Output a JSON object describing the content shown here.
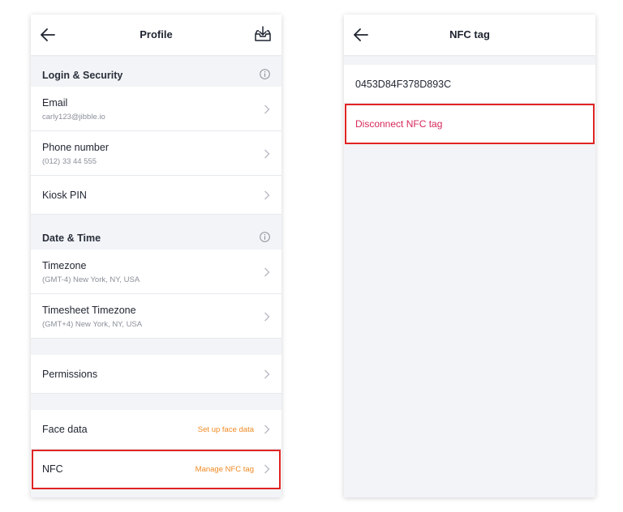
{
  "profile": {
    "title": "Profile",
    "sections": {
      "login": {
        "label": "Login & Security",
        "email": {
          "label": "Email",
          "value": "carly123@jibble.io"
        },
        "phone": {
          "label": "Phone number",
          "value": "(012) 33 44 555"
        },
        "kiosk": {
          "label": "Kiosk PIN"
        }
      },
      "datetime": {
        "label": "Date & Time",
        "timezone": {
          "label": "Timezone",
          "value": "(GMT-4) New York, NY, USA"
        },
        "timesheet_timezone": {
          "label": "Timesheet Timezone",
          "value": "(GMT+4) New York, NY, USA"
        }
      },
      "permissions": {
        "label": "Permissions"
      },
      "face_data": {
        "label": "Face data",
        "action": "Set up face data"
      },
      "nfc": {
        "label": "NFC",
        "action": "Manage NFC tag"
      }
    }
  },
  "nfc_screen": {
    "title": "NFC tag",
    "tag_id": "0453D84F378D893C",
    "disconnect_label": "Disconnect NFC tag"
  },
  "colors": {
    "accent_orange": "#f08a24",
    "danger_pink": "#d6285a",
    "highlight_red": "#e02424",
    "background_gray": "#f2f4f7"
  }
}
